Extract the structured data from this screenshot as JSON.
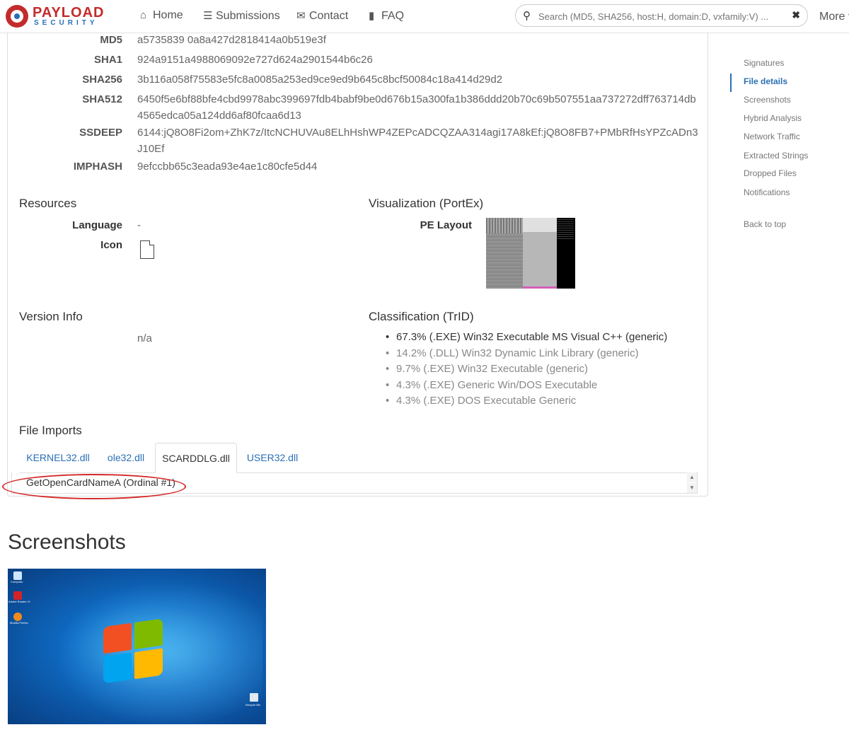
{
  "navbar": {
    "logo_top": "PAYLOAD",
    "logo_bottom": "SECURITY",
    "items": [
      {
        "label": "Home",
        "icon": "home-icon"
      },
      {
        "label": "Submissions",
        "icon": "list-icon"
      },
      {
        "label": "Contact",
        "icon": "envelope-icon"
      },
      {
        "label": "FAQ",
        "icon": "book-icon"
      }
    ],
    "search_placeholder": "Search (MD5, SHA256, host:H, domain:D, vxfamily:V) ...",
    "more_label": "More"
  },
  "hashes": [
    {
      "key": "MD5",
      "value": "a5735839 0a8a427d2818414a0b519e3f"
    },
    {
      "key": "SHA1",
      "value": "924a9151a4988069092e727d624a2901544b6c26"
    },
    {
      "key": "SHA256",
      "value": "3b116a058f75583e5fc8a0085a253ed9ce9ed9b645c8bcf50084c18a414d29d2"
    },
    {
      "key": "SHA512",
      "value": "6450f5e6bf88bfe4cbd9978abc399697fdb4babf9be0d676b15a300fa1b386ddd20b70c69b507551aa737272dff763714db4565edca05a124dd6af80fcaa6d13"
    },
    {
      "key": "SSDEEP",
      "value": "6144:jQ8O8Fi2om+ZhK7z/ItcNCHUVAu8ELhHshWP4ZEPcADCQZAA314agi17A8kEf:jQ8O8FB7+PMbRfHsYPZcADn3J10Ef"
    },
    {
      "key": "IMPHASH",
      "value": "9efccbb65c3eada93e4ae1c80cfe5d44"
    }
  ],
  "resources": {
    "title": "Resources",
    "language_label": "Language",
    "language_value": "-",
    "icon_label": "Icon"
  },
  "visualization": {
    "title": "Visualization (PortEx)",
    "pe_layout_label": "PE Layout"
  },
  "version_info": {
    "title": "Version Info",
    "value": "n/a"
  },
  "classification": {
    "title": "Classification (TrID)",
    "items": [
      "67.3% (.EXE) Win32 Executable MS Visual C++ (generic)",
      "14.2% (.DLL) Win32 Dynamic Link Library (generic)",
      "9.7% (.EXE) Win32 Executable (generic)",
      "4.3% (.EXE) Generic Win/DOS Executable",
      "4.3% (.EXE) DOS Executable Generic"
    ]
  },
  "file_imports": {
    "title": "File Imports",
    "tabs": [
      "KERNEL32.dll",
      "ole32.dll",
      "SCARDDLG.dll",
      "USER32.dll"
    ],
    "active_tab": "SCARDDLG.dll",
    "items": [
      "GetOpenCardNameA (Ordinal #1)"
    ]
  },
  "toc": {
    "items": [
      "Signatures",
      "File details",
      "Screenshots",
      "Hybrid Analysis",
      "Network Traffic",
      "Extracted Strings",
      "Dropped Files",
      "Notifications"
    ],
    "active": "File details",
    "back_to_top": "Back to top"
  },
  "screenshots": {
    "title": "Screenshots",
    "desktop_icons": [
      "Computer",
      "Adobe Reader XI",
      "Mozilla Firefox",
      "Recycle Bin"
    ]
  },
  "colors": {
    "accent": "#2a6fb5",
    "brand_red": "#c42b2b",
    "highlight": "#d42a2a"
  }
}
